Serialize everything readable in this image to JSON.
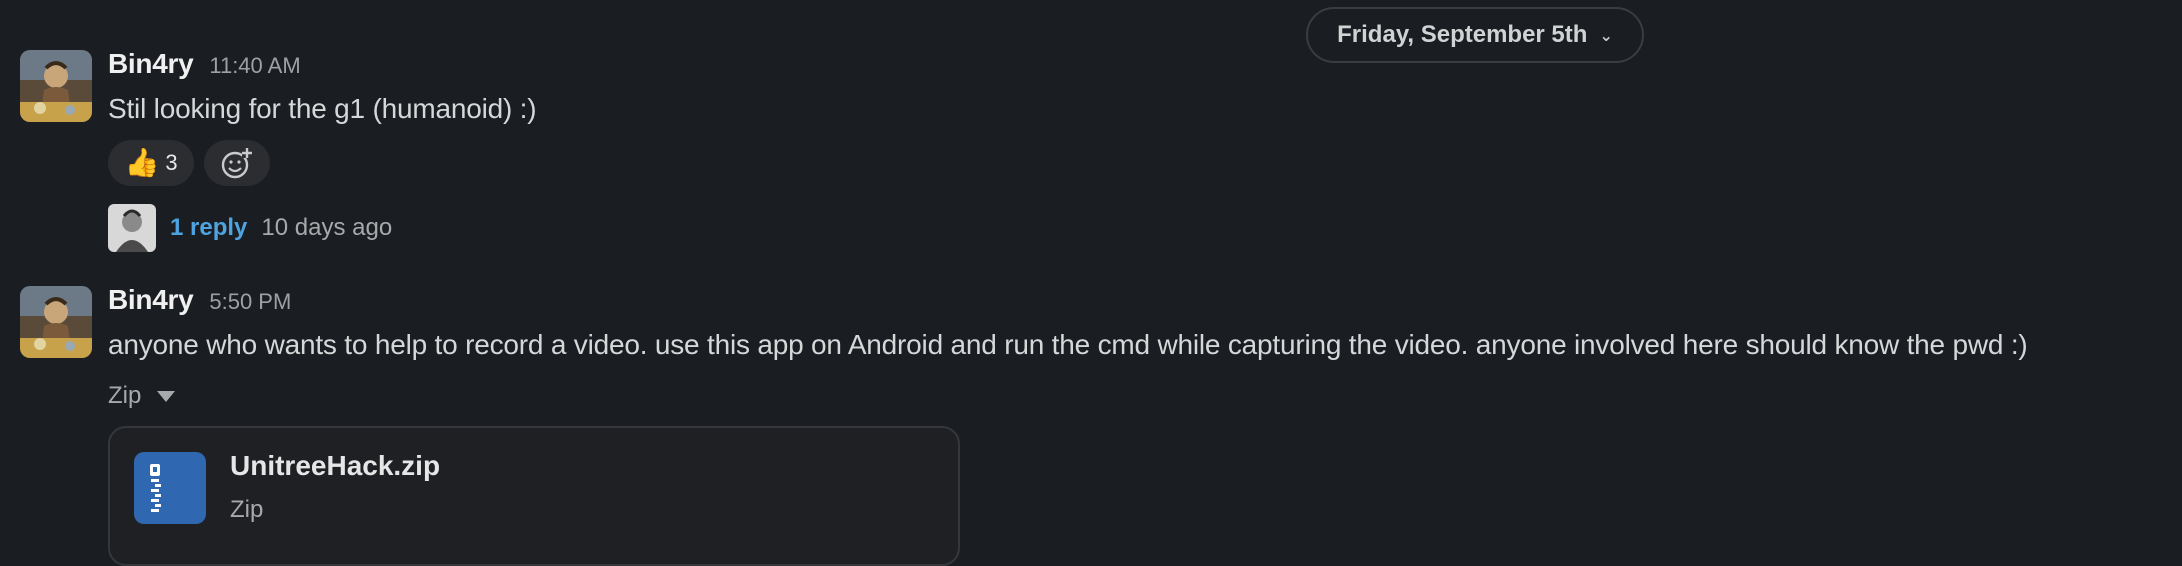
{
  "date_divider": {
    "label": "Friday, September 5th"
  },
  "messages": [
    {
      "author": "Bin4ry",
      "time": "11:40 AM",
      "text": "Stil looking for the g1 (humanoid) :)",
      "reactions": [
        {
          "emoji": "👍",
          "count": "3"
        }
      ],
      "add_reaction_icon": "add-emoji-icon",
      "thread": {
        "reply_label": "1 reply",
        "last_reply": "10 days ago"
      }
    },
    {
      "author": "Bin4ry",
      "time": "5:50 PM",
      "text": "anyone who wants to help to record a video. use this app on Android and run the cmd while capturing the video. anyone involved here should know the pwd :)",
      "attachment_toggle": "Zip",
      "file": {
        "name": "UnitreeHack.zip",
        "type": "Zip",
        "icon": "zip-file-icon"
      }
    }
  ],
  "colors": {
    "background": "#1a1d21",
    "link": "#4fa3e0",
    "file_icon": "#2f68b0"
  }
}
